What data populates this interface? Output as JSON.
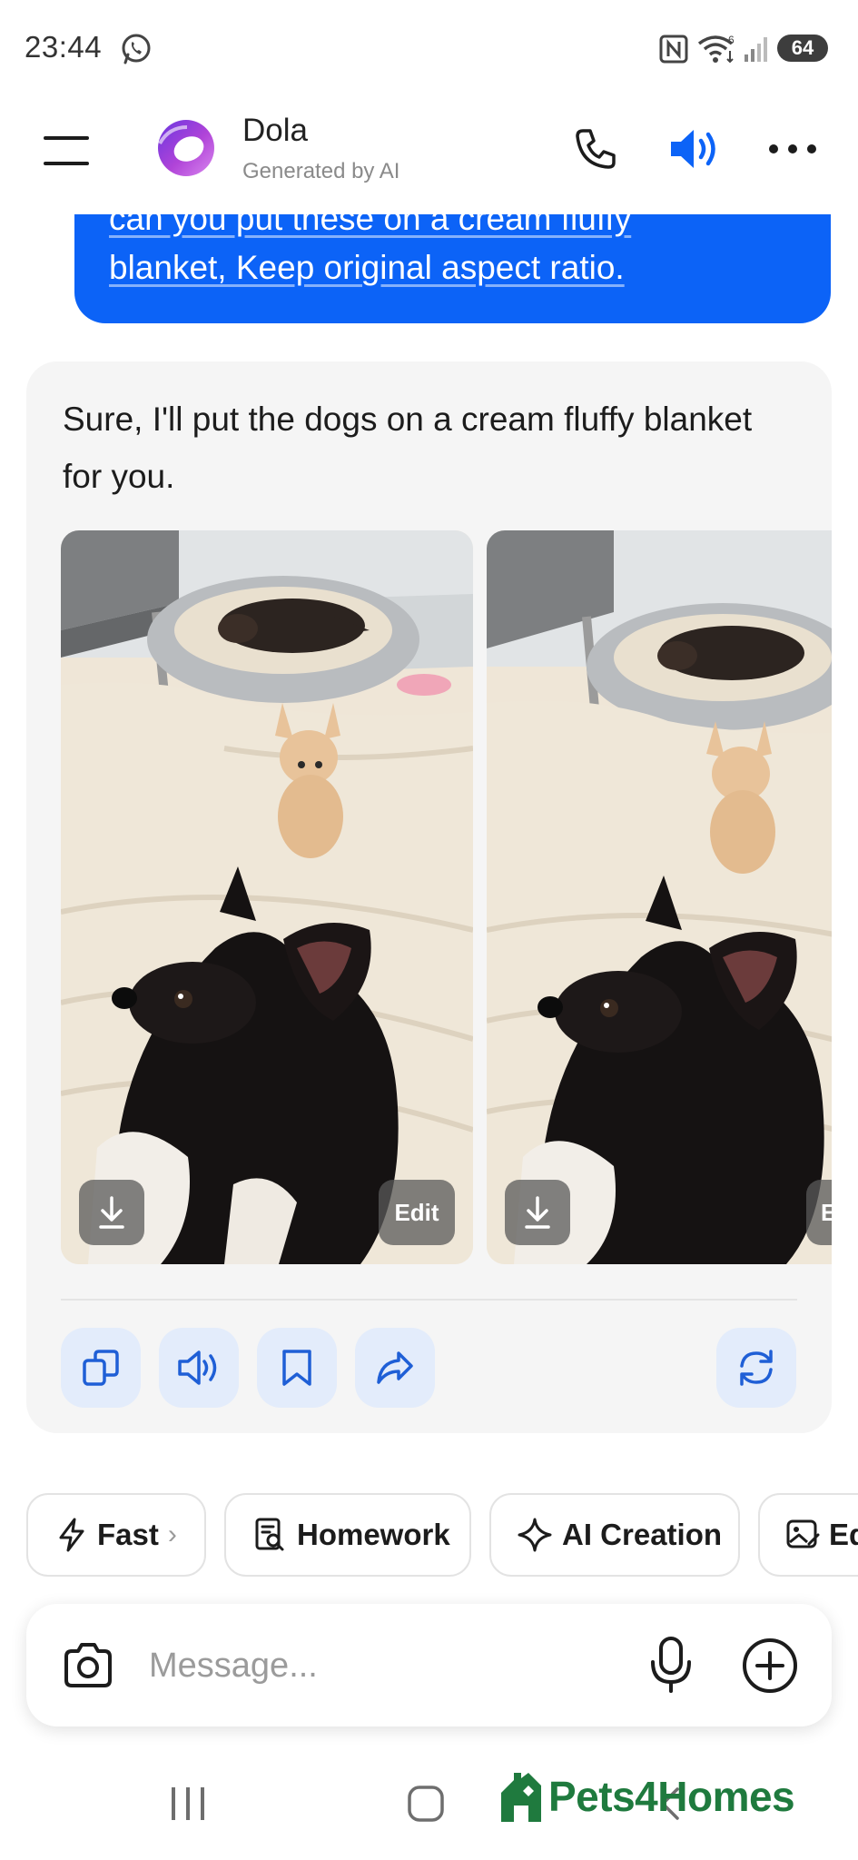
{
  "status_bar": {
    "time": "23:44",
    "battery": "64",
    "icons": [
      "whatsapp-icon",
      "nfc-icon",
      "wifi-icon",
      "signal-icon",
      "battery-icon"
    ]
  },
  "header": {
    "title": "Dola",
    "subtitle": "Generated by AI",
    "icons": [
      "menu-icon",
      "dola-logo",
      "phone-icon",
      "speaker-icon",
      "more-icon"
    ],
    "accent_color": "#0c63f7"
  },
  "user_message": {
    "lines": [
      "can you put these on a cream fluffy",
      "blanket,  Keep original aspect ratio."
    ],
    "bubble_color": "#0c63f7"
  },
  "ai_message": {
    "text": "Sure, I'll put the dogs on a cream fluffy blanket for you.",
    "images": [
      {
        "edit_label": "Edit",
        "download_icon": "download-icon"
      },
      {
        "edit_label": "E",
        "download_icon": "download-icon"
      }
    ],
    "actions": [
      "copy-icon",
      "read-aloud-icon",
      "bookmark-icon",
      "share-icon",
      "regenerate-icon"
    ]
  },
  "chips": [
    {
      "label": "Fast",
      "icon": "lightning-icon",
      "chevron": "›"
    },
    {
      "label": "Homework",
      "icon": "homework-icon"
    },
    {
      "label": "AI Creation",
      "icon": "sparkle-icon"
    },
    {
      "label": "Ed",
      "icon": "image-edit-icon"
    }
  ],
  "composer": {
    "placeholder": "Message...",
    "icons": [
      "camera-icon",
      "mic-icon",
      "plus-icon"
    ]
  },
  "watermark": {
    "text": "Pets4Homes",
    "color": "#1f7a3e"
  },
  "nav": [
    "recent-apps-icon",
    "home-icon",
    "back-icon"
  ]
}
